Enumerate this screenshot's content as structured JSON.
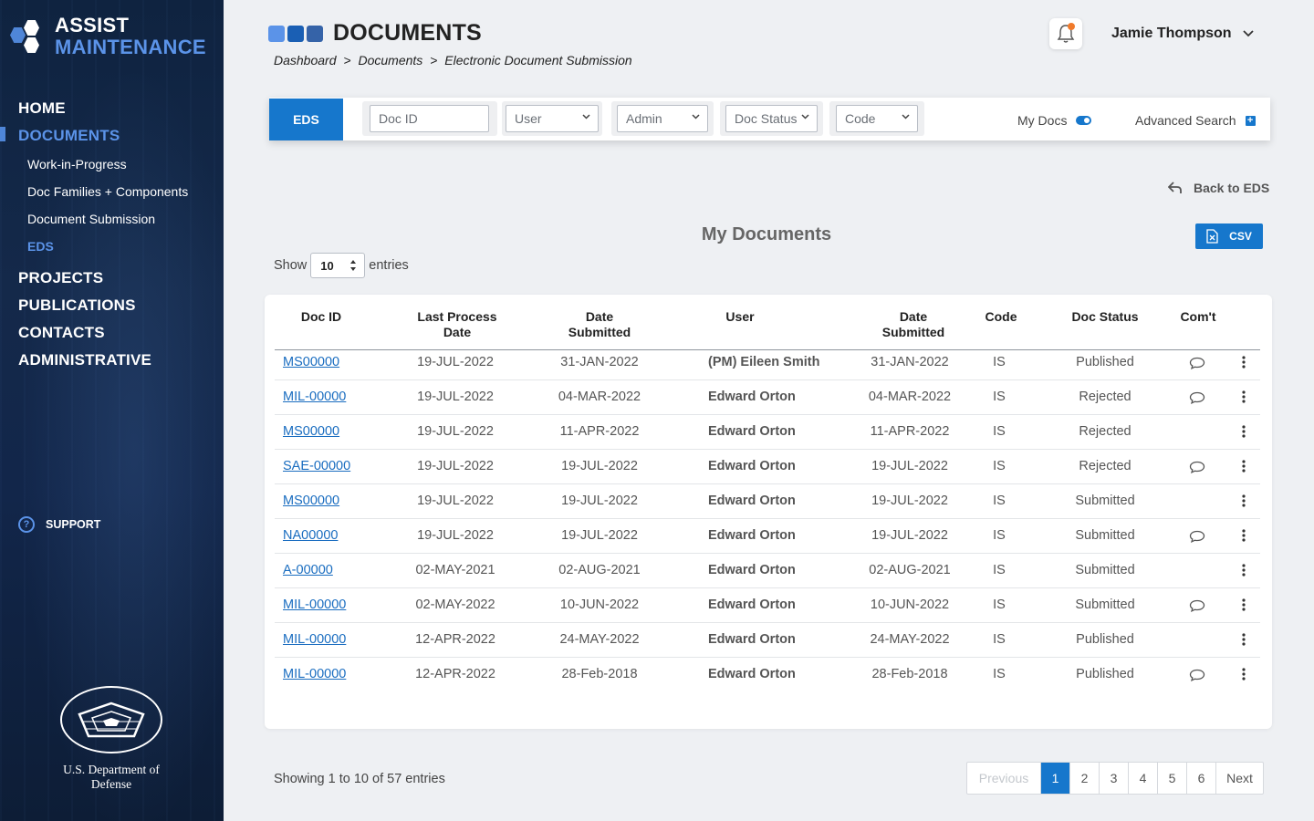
{
  "brand": {
    "line1": "ASSIST",
    "line2": "MAINTENANCE"
  },
  "nav": {
    "home": "HOME",
    "documents": "DOCUMENTS",
    "sub": [
      "Work-in-Progress",
      "Doc Families + Components",
      "Document Submission",
      "EDS"
    ],
    "projects": "PROJECTS",
    "publications": "PUBLICATIONS",
    "contacts": "CONTACTS",
    "administrative": "ADMINISTRATIVE",
    "support": "SUPPORT",
    "support_icon": "?"
  },
  "dod_label": "U.S. Department of Defense",
  "header": {
    "title": "DOCUMENTS",
    "breadcrumb": [
      "Dashboard",
      ">",
      "Documents",
      ">",
      "Electronic Document Submission"
    ],
    "user": "Jamie Thompson"
  },
  "filters": {
    "eds": "EDS",
    "doc_id_placeholder": "Doc ID",
    "user": "User",
    "admin": "Admin",
    "doc_status": "Doc Status",
    "code": "Code",
    "my_docs": "My Docs",
    "my_docs_on": true,
    "advanced_search": "Advanced Search"
  },
  "back_to_eds": "Back to EDS",
  "section_title": "My Documents",
  "csv_label": "CSV",
  "show": {
    "prefix": "Show",
    "value": "10",
    "suffix": "entries"
  },
  "columns": [
    "Doc ID",
    "Last Process\nDate",
    "Date\nSubmitted",
    "User",
    "Date\nSubmitted",
    "Code",
    "Doc Status",
    "Com't"
  ],
  "rows": [
    {
      "doc_id": "MS00000",
      "last_process": "19-JUL-2022",
      "date_submitted": "31-JAN-2022",
      "user": "(PM) Eileen Smith",
      "date_submitted2": "31-JAN-2022",
      "code": "IS",
      "status": "Published",
      "comment": true
    },
    {
      "doc_id": "MIL-00000",
      "last_process": "19-JUL-2022",
      "date_submitted": "04-MAR-2022",
      "user": "Edward Orton",
      "date_submitted2": "04-MAR-2022",
      "code": "IS",
      "status": "Rejected",
      "comment": true
    },
    {
      "doc_id": "MS00000",
      "last_process": "19-JUL-2022",
      "date_submitted": "11-APR-2022",
      "user": "Edward Orton",
      "date_submitted2": "11-APR-2022",
      "code": "IS",
      "status": "Rejected",
      "comment": false
    },
    {
      "doc_id": "SAE-00000",
      "last_process": "19-JUL-2022",
      "date_submitted": "19-JUL-2022",
      "user": "Edward Orton",
      "date_submitted2": "19-JUL-2022",
      "code": "IS",
      "status": "Rejected",
      "comment": true
    },
    {
      "doc_id": "MS00000",
      "last_process": "19-JUL-2022",
      "date_submitted": "19-JUL-2022",
      "user": "Edward Orton",
      "date_submitted2": "19-JUL-2022",
      "code": "IS",
      "status": "Submitted",
      "comment": false
    },
    {
      "doc_id": "NA00000",
      "last_process": "19-JUL-2022",
      "date_submitted": "19-JUL-2022",
      "user": "Edward Orton",
      "date_submitted2": "19-JUL-2022",
      "code": "IS",
      "status": "Submitted",
      "comment": true
    },
    {
      "doc_id": "A-00000",
      "last_process": "02-MAY-2021",
      "date_submitted": "02-AUG-2021",
      "user": "Edward Orton",
      "date_submitted2": "02-AUG-2021",
      "code": "IS",
      "status": "Submitted",
      "comment": false
    },
    {
      "doc_id": "MIL-00000",
      "last_process": "02-MAY-2022",
      "date_submitted": "10-JUN-2022",
      "user": "Edward Orton",
      "date_submitted2": "10-JUN-2022",
      "code": "IS",
      "status": "Submitted",
      "comment": true
    },
    {
      "doc_id": "MIL-00000",
      "last_process": "12-APR-2022",
      "date_submitted": "24-MAY-2022",
      "user": "Edward Orton",
      "date_submitted2": "24-MAY-2022",
      "code": "IS",
      "status": "Published",
      "comment": false
    },
    {
      "doc_id": "MIL-00000",
      "last_process": "12-APR-2022",
      "date_submitted": "28-Feb-2018",
      "user": "Edward Orton",
      "date_submitted2": "28-Feb-2018",
      "code": "IS",
      "status": "Published",
      "comment": true
    }
  ],
  "footer": {
    "showing": "Showing 1 to 10 of 57 entries",
    "pages": [
      "Previous",
      "1",
      "2",
      "3",
      "4",
      "5",
      "6",
      "Next"
    ],
    "active_page": "1"
  },
  "colors": {
    "accent": "#1677cc",
    "sidebar": "#12264a",
    "nav_active": "#5b93e8",
    "notification": "#f07a2b"
  },
  "icons": {
    "bell": "bell-icon",
    "comment": "comment-icon",
    "kebab": "kebab-icon",
    "back": "back-arrow-icon",
    "csv": "excel-file-icon"
  }
}
